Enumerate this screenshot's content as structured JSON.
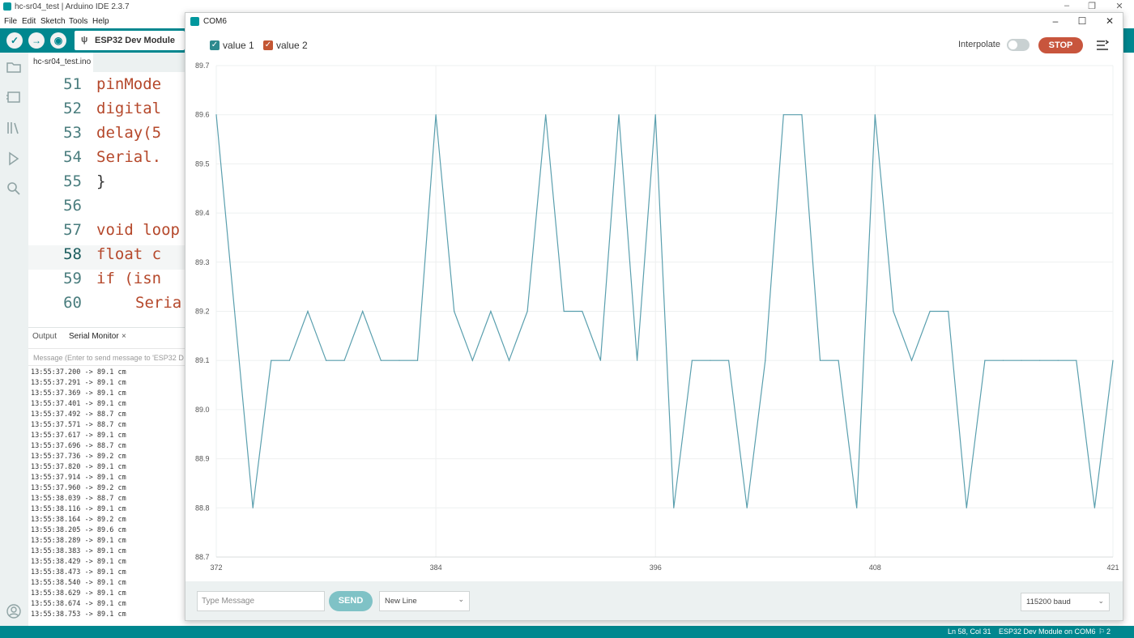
{
  "ide": {
    "window_title": "hc-sr04_test | Arduino IDE 2.3.7",
    "menu": [
      "File",
      "Edit",
      "Sketch",
      "Tools",
      "Help"
    ],
    "board": "ESP32 Dev Module",
    "file_tab": "hc-sr04_test.ino",
    "code_lines": [
      {
        "num": "51",
        "text": "pinMode"
      },
      {
        "num": "52",
        "text": "digital"
      },
      {
        "num": "53",
        "text": "delay(5"
      },
      {
        "num": "54",
        "text": "Serial."
      },
      {
        "num": "55",
        "text": "}"
      },
      {
        "num": "56",
        "text": ""
      },
      {
        "num": "57",
        "text": "void loop"
      },
      {
        "num": "58",
        "text": "float c"
      },
      {
        "num": "59",
        "text": "if (isn"
      },
      {
        "num": "60",
        "text": "Seria"
      }
    ],
    "panel_tabs": {
      "output": "Output",
      "serial_monitor": "Serial Monitor",
      "close": "×"
    },
    "monitor_placeholder": "Message (Enter to send message to 'ESP32 D",
    "monitor_log": [
      "13:55:37.200 -> 89.1 cm",
      "13:55:37.291 -> 89.1 cm",
      "13:55:37.369 -> 89.1 cm",
      "13:55:37.401 -> 89.1 cm",
      "13:55:37.492 -> 88.7 cm",
      "13:55:37.571 -> 88.7 cm",
      "13:55:37.617 -> 89.1 cm",
      "13:55:37.696 -> 88.7 cm",
      "13:55:37.736 -> 89.2 cm",
      "13:55:37.820 -> 89.1 cm",
      "13:55:37.914 -> 89.1 cm",
      "13:55:37.960 -> 89.2 cm",
      "13:55:38.039 -> 88.7 cm",
      "13:55:38.116 -> 89.1 cm",
      "13:55:38.164 -> 89.2 cm",
      "13:55:38.205 -> 89.6 cm",
      "13:55:38.289 -> 89.1 cm",
      "13:55:38.383 -> 89.1 cm",
      "13:55:38.429 -> 89.1 cm",
      "13:55:38.473 -> 89.1 cm",
      "13:55:38.540 -> 89.1 cm",
      "13:55:38.629 -> 89.1 cm",
      "13:55:38.674 -> 89.1 cm",
      "13:55:38.753 -> 89.1 cm"
    ],
    "status": {
      "cursor": "Ln 58, Col 31",
      "board_port": "ESP32 Dev Module on COM6",
      "notifications": "2"
    },
    "accent_color": "#00878f"
  },
  "plotter": {
    "window_title": "COM6",
    "legend": [
      {
        "label": "value 1",
        "checked": true,
        "color": "#2d8a8f"
      },
      {
        "label": "value 2",
        "checked": true,
        "color": "#c35634"
      }
    ],
    "interpolate_label": "Interpolate",
    "interpolate_on": false,
    "stop_label": "STOP",
    "message_placeholder": "Type Message",
    "send_label": "SEND",
    "line_ending": "New Line",
    "baud": "115200 baud",
    "stop_color": "#c8553d"
  },
  "chart_data": {
    "type": "line",
    "xlim": [
      372,
      421
    ],
    "ylim": [
      88.7,
      89.7
    ],
    "x_ticks": [
      372,
      384,
      396,
      408,
      421
    ],
    "y_ticks": [
      "89.7",
      "89.6",
      "89.5",
      "89.4",
      "89.3",
      "89.2",
      "89.1",
      "89.0",
      "88.9",
      "88.8",
      "88.7"
    ],
    "grid": true,
    "series": [
      {
        "name": "value 1",
        "color": "#5a9fae",
        "x": [
          372,
          373,
          374,
          375,
          376,
          377,
          378,
          379,
          380,
          381,
          382,
          383,
          384,
          385,
          386,
          387,
          388,
          389,
          390,
          391,
          392,
          393,
          394,
          395,
          396,
          397,
          398,
          399,
          400,
          401,
          402,
          403,
          404,
          405,
          406,
          407,
          408,
          409,
          410,
          411,
          412,
          413,
          414,
          415,
          416,
          417,
          418,
          419,
          420,
          421
        ],
        "values": [
          89.6,
          89.2,
          88.8,
          89.1,
          89.1,
          89.2,
          89.1,
          89.1,
          89.2,
          89.1,
          89.1,
          89.1,
          89.6,
          89.2,
          89.1,
          89.2,
          89.1,
          89.2,
          89.6,
          89.2,
          89.2,
          89.1,
          89.6,
          89.1,
          89.6,
          88.8,
          89.1,
          89.1,
          89.1,
          88.8,
          89.1,
          89.6,
          89.6,
          89.1,
          89.1,
          88.8,
          89.6,
          89.2,
          89.1,
          89.2,
          89.2,
          88.8,
          89.1,
          89.1,
          89.1,
          89.1,
          89.1,
          89.1,
          88.8,
          89.1
        ]
      }
    ]
  }
}
